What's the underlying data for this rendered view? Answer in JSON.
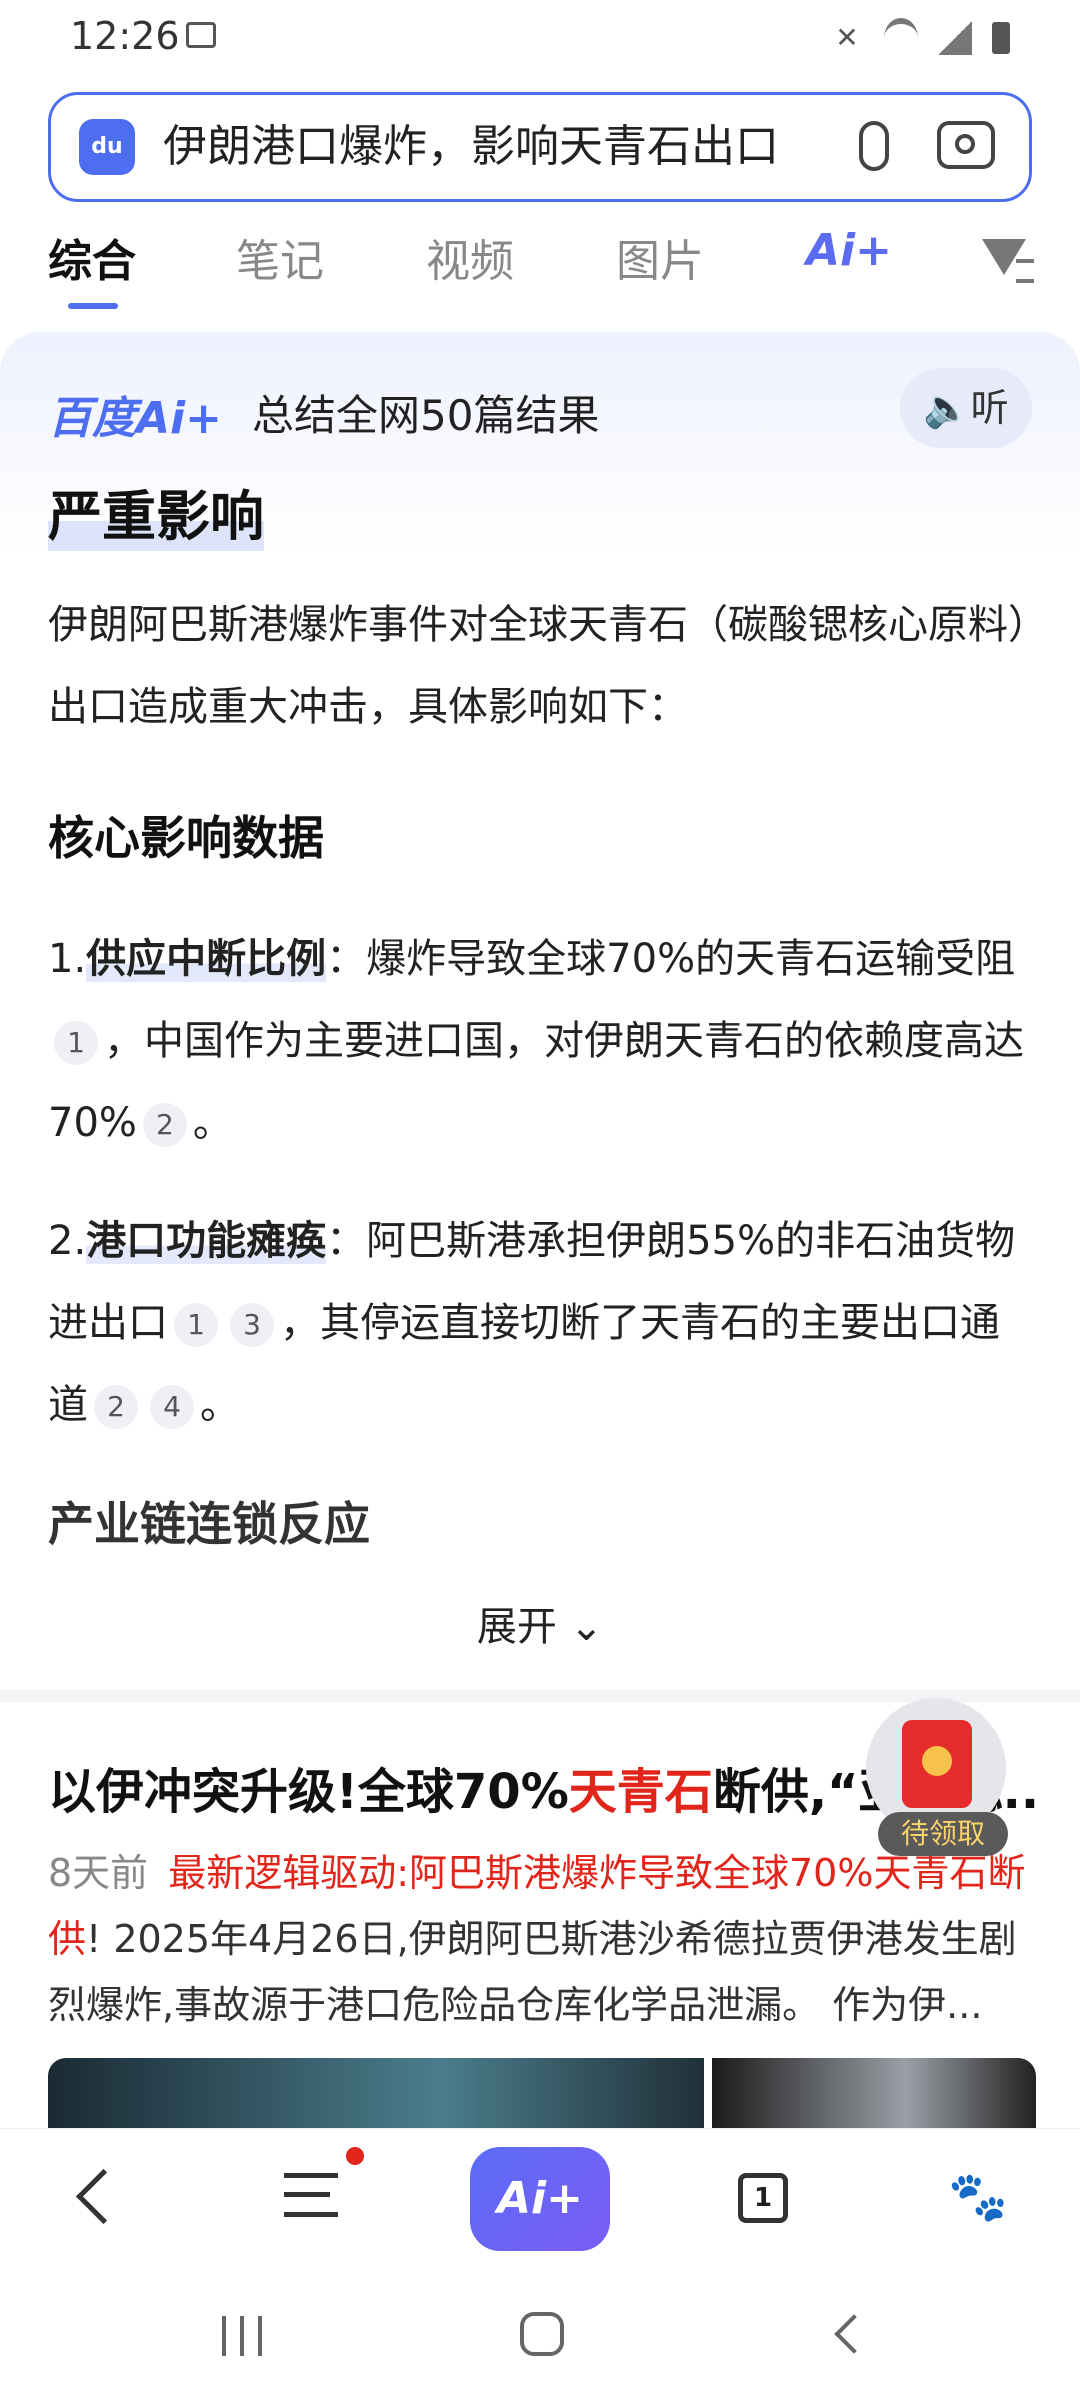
{
  "status_bar": {
    "time": "12:26",
    "icons": [
      "gallery-icon",
      "mute-icon",
      "wifi-icon",
      "signal-icon",
      "battery-icon"
    ]
  },
  "search": {
    "query": "伊朗港口爆炸，影响天青石出口",
    "logo_text": "du"
  },
  "tabs": [
    {
      "label": "综合",
      "active": true
    },
    {
      "label": "笔记"
    },
    {
      "label": "视频"
    },
    {
      "label": "图片"
    },
    {
      "label": "Ai+"
    }
  ],
  "ai_card": {
    "brand": "百度Ai+",
    "summary": "总结全网50篇结果",
    "listen_label": "听",
    "heading": "严重影响",
    "intro": "伊朗阿巴斯港爆炸事件对全球天青石（碳酸锶核心原料）出口造成重大冲击，具体影响如下：",
    "section1": "核心影响数据",
    "item1": {
      "num": "1.",
      "key": "供应中断比例",
      "text_a": "：爆炸导致全球70%的天青石运输受阻",
      "cite_a": "1",
      "text_b": "，中国作为主要进口国，对伊朗天青石的依赖度高达70%",
      "cite_b": "2",
      "text_c": "。"
    },
    "item2": {
      "num": "2.",
      "key": "港口功能瘫痪",
      "text_a": "：阿巴斯港承担伊朗55%的非石油货物进出口",
      "cite_a": "1",
      "cite_b": "3",
      "text_b": "，其停运直接切断了天青石的主要出口通道",
      "cite_c": "2",
      "cite_d": "4",
      "text_c": "。"
    },
    "section2": "产业链连锁反应",
    "expand_label": "展开"
  },
  "result": {
    "title_a": "以伊冲突升级!全球70%",
    "title_red": "天青石",
    "title_b": "断供,“亚洲锶...",
    "time": "8天前",
    "snippet_red": "最新逻辑驱动:阿巴斯港爆炸导致全球70%天青石断供",
    "snippet": "! 2025年4月26日,伊朗阿巴斯港沙希德拉贾伊港发生剧烈爆炸,事故源于港口危险品仓库化学品泄漏。 作为伊..."
  },
  "red_packet": {
    "label": "待领取"
  },
  "bottom_nav": {
    "ai_label": "Ai+",
    "pages_count": "1"
  },
  "colors": {
    "accent": "#4e6ef2",
    "red": "#e1251b"
  }
}
